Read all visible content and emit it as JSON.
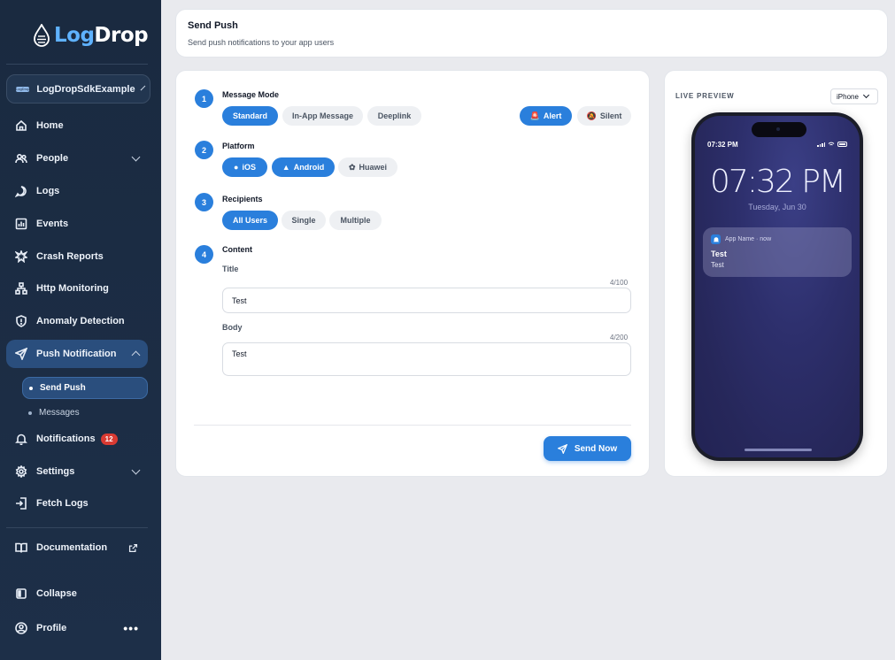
{
  "brand": {
    "part1": "Log",
    "part2": "Drop"
  },
  "app_selector": {
    "mini_label": "LogDrop",
    "name": "LogDropSdkExample"
  },
  "nav": {
    "home": "Home",
    "people": "People",
    "logs": "Logs",
    "events": "Events",
    "crash_reports": "Crash Reports",
    "http_monitoring": "Http Monitoring",
    "anomaly_detection": "Anomaly Detection",
    "push_notification": "Push Notification",
    "send_push": "Send Push",
    "messages": "Messages",
    "notifications": "Notifications",
    "notifications_badge": "12",
    "settings": "Settings",
    "fetch_logs": "Fetch Logs",
    "documentation": "Documentation",
    "collapse": "Collapse",
    "profile": "Profile",
    "profile_menu": "•••"
  },
  "header": {
    "title": "Send Push",
    "subtitle": "Send push notifications to your app users"
  },
  "form": {
    "steps": [
      {
        "number": "1",
        "label": "Message Mode"
      },
      {
        "number": "2",
        "label": "Platform"
      },
      {
        "number": "3",
        "label": "Recipients"
      },
      {
        "number": "4",
        "label": "Content"
      }
    ],
    "message_modes": [
      "Standard",
      "In-App Message",
      "Deeplink"
    ],
    "message_mode_selected": "Standard",
    "alert_types": [
      "Alert",
      "Silent"
    ],
    "alert_type_selected": "Alert",
    "platforms": [
      "iOS",
      "Android",
      "Huawei"
    ],
    "platforms_selected": [
      "iOS",
      "Android"
    ],
    "recipients": [
      "All Users",
      "Single",
      "Multiple"
    ],
    "recipients_selected": "All Users",
    "title_label": "Title",
    "title_counter": "4/100",
    "title_value": "Test",
    "body_label": "Body",
    "body_counter": "4/200",
    "body_value": "Test",
    "send_label": "Send Now"
  },
  "preview": {
    "label": "LIVE PREVIEW",
    "device": "iPhone",
    "status_time": "07:32 PM",
    "lock_time": "07:32 PM",
    "date": "Tuesday, Jun 30",
    "notification": {
      "app": "App Name · now",
      "title": "Test",
      "body": "Test"
    }
  },
  "colors": {
    "accent": "#2a7fdc",
    "sidebar": "#1a2a40",
    "badge": "#d93a32"
  }
}
